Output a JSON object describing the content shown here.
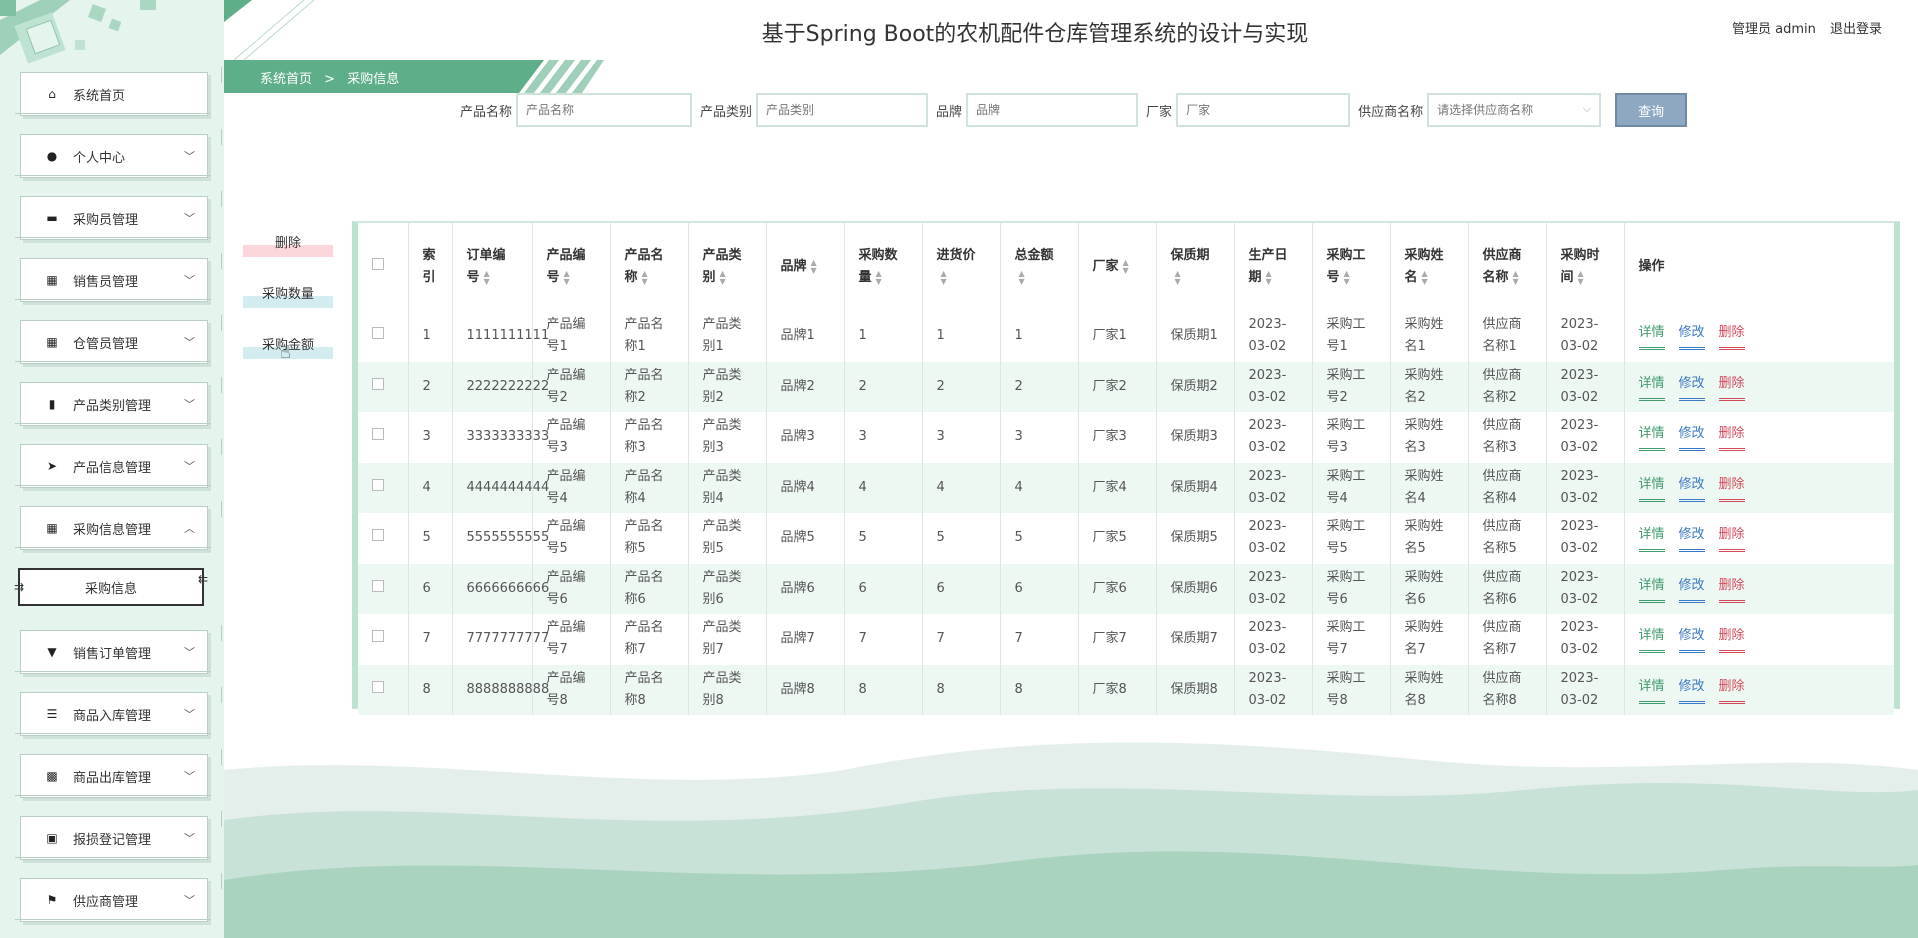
{
  "header": {
    "title": "基于Spring Boot的农机配件仓库管理系统的设计与实现",
    "user_label": "管理员 admin",
    "logout_label": "退出登录"
  },
  "breadcrumb": {
    "home": "系统首页",
    "separator": ">",
    "current": "采购信息"
  },
  "sidebar": {
    "items": [
      {
        "label": "系统首页",
        "icon": "home-icon"
      },
      {
        "label": "个人中心",
        "icon": "user-icon"
      },
      {
        "label": "采购员管理",
        "icon": "briefcase-icon"
      },
      {
        "label": "销售员管理",
        "icon": "grid-icon"
      },
      {
        "label": "仓管员管理",
        "icon": "grid-icon"
      },
      {
        "label": "产品类别管理",
        "icon": "bar-chart-icon"
      },
      {
        "label": "产品信息管理",
        "icon": "send-icon"
      },
      {
        "label": "采购信息管理",
        "icon": "grid-icon"
      },
      {
        "label": "销售订单管理",
        "icon": "stamp-icon"
      },
      {
        "label": "商品入库管理",
        "icon": "sliders-icon"
      },
      {
        "label": "商品出库管理",
        "icon": "apps-icon"
      },
      {
        "label": "报损登记管理",
        "icon": "wallet-icon"
      },
      {
        "label": "供应商管理",
        "icon": "flag-icon"
      }
    ],
    "sub_item": "采购信息"
  },
  "search": {
    "fields": [
      {
        "label": "产品名称",
        "placeholder": "产品名称"
      },
      {
        "label": "产品类别",
        "placeholder": "产品类别"
      },
      {
        "label": "品牌",
        "placeholder": "品牌"
      },
      {
        "label": "厂家",
        "placeholder": "厂家"
      }
    ],
    "supplier_label": "供应商名称",
    "supplier_placeholder": "请选择供应商名称",
    "query_label": "查询"
  },
  "side_actions": [
    {
      "label": "删除",
      "color": "#fbd6da"
    },
    {
      "label": "采购数量",
      "color": "#d3ecf0"
    },
    {
      "label": "采购金额",
      "color": "#d3ecf0"
    }
  ],
  "table": {
    "columns": [
      "索引",
      "订单编号",
      "产品编号",
      "产品名称",
      "产品类别",
      "品牌",
      "采购数量",
      "进货价",
      "总金额",
      "厂家",
      "保质期",
      "生产日期",
      "采购工号",
      "采购姓名",
      "供应商名称",
      "采购时间",
      "操作"
    ],
    "rows": [
      {
        "idx": "1",
        "order": "1111111111",
        "pno": "产品编号1",
        "pname": "产品名称1",
        "ptype": "产品类别1",
        "brand": "品牌1",
        "qty": "1",
        "price": "1",
        "total": "1",
        "maker": "厂家1",
        "shelf": "保质期1",
        "pdate": "2023-03-02",
        "wno": "采购工号1",
        "wname": "采购姓名1",
        "supplier": "供应商名称1",
        "ptime": "2023-03-02"
      },
      {
        "idx": "2",
        "order": "2222222222",
        "pno": "产品编号2",
        "pname": "产品名称2",
        "ptype": "产品类别2",
        "brand": "品牌2",
        "qty": "2",
        "price": "2",
        "total": "2",
        "maker": "厂家2",
        "shelf": "保质期2",
        "pdate": "2023-03-02",
        "wno": "采购工号2",
        "wname": "采购姓名2",
        "supplier": "供应商名称2",
        "ptime": "2023-03-02"
      },
      {
        "idx": "3",
        "order": "3333333333",
        "pno": "产品编号3",
        "pname": "产品名称3",
        "ptype": "产品类别3",
        "brand": "品牌3",
        "qty": "3",
        "price": "3",
        "total": "3",
        "maker": "厂家3",
        "shelf": "保质期3",
        "pdate": "2023-03-02",
        "wno": "采购工号3",
        "wname": "采购姓名3",
        "supplier": "供应商名称3",
        "ptime": "2023-03-02"
      },
      {
        "idx": "4",
        "order": "4444444444",
        "pno": "产品编号4",
        "pname": "产品名称4",
        "ptype": "产品类别4",
        "brand": "品牌4",
        "qty": "4",
        "price": "4",
        "total": "4",
        "maker": "厂家4",
        "shelf": "保质期4",
        "pdate": "2023-03-02",
        "wno": "采购工号4",
        "wname": "采购姓名4",
        "supplier": "供应商名称4",
        "ptime": "2023-03-02"
      },
      {
        "idx": "5",
        "order": "5555555555",
        "pno": "产品编号5",
        "pname": "产品名称5",
        "ptype": "产品类别5",
        "brand": "品牌5",
        "qty": "5",
        "price": "5",
        "total": "5",
        "maker": "厂家5",
        "shelf": "保质期5",
        "pdate": "2023-03-02",
        "wno": "采购工号5",
        "wname": "采购姓名5",
        "supplier": "供应商名称5",
        "ptime": "2023-03-02"
      },
      {
        "idx": "6",
        "order": "6666666666",
        "pno": "产品编号6",
        "pname": "产品名称6",
        "ptype": "产品类别6",
        "brand": "品牌6",
        "qty": "6",
        "price": "6",
        "total": "6",
        "maker": "厂家6",
        "shelf": "保质期6",
        "pdate": "2023-03-02",
        "wno": "采购工号6",
        "wname": "采购姓名6",
        "supplier": "供应商名称6",
        "ptime": "2023-03-02"
      },
      {
        "idx": "7",
        "order": "7777777777",
        "pno": "产品编号7",
        "pname": "产品名称7",
        "ptype": "产品类别7",
        "brand": "品牌7",
        "qty": "7",
        "price": "7",
        "total": "7",
        "maker": "厂家7",
        "shelf": "保质期7",
        "pdate": "2023-03-02",
        "wno": "采购工号7",
        "wname": "采购姓名7",
        "supplier": "供应商名称7",
        "ptime": "2023-03-02"
      },
      {
        "idx": "8",
        "order": "8888888888",
        "pno": "产品编号8",
        "pname": "产品名称8",
        "ptype": "产品类别8",
        "brand": "品牌8",
        "qty": "8",
        "price": "8",
        "total": "8",
        "maker": "厂家8",
        "shelf": "保质期8",
        "pdate": "2023-03-02",
        "wno": "采购工号8",
        "wname": "采购姓名8",
        "supplier": "供应商名称8",
        "ptime": "2023-03-02"
      }
    ],
    "actions": {
      "detail": "详情",
      "edit": "修改",
      "delete": "删除"
    }
  },
  "colors": {
    "primary": "#5fae8a",
    "sidebar_bg": "#e6f4ee",
    "stripe": "#eef8f3",
    "detail": "#3f9a6e",
    "edit": "#3a79c7",
    "delete": "#d24a5a"
  }
}
